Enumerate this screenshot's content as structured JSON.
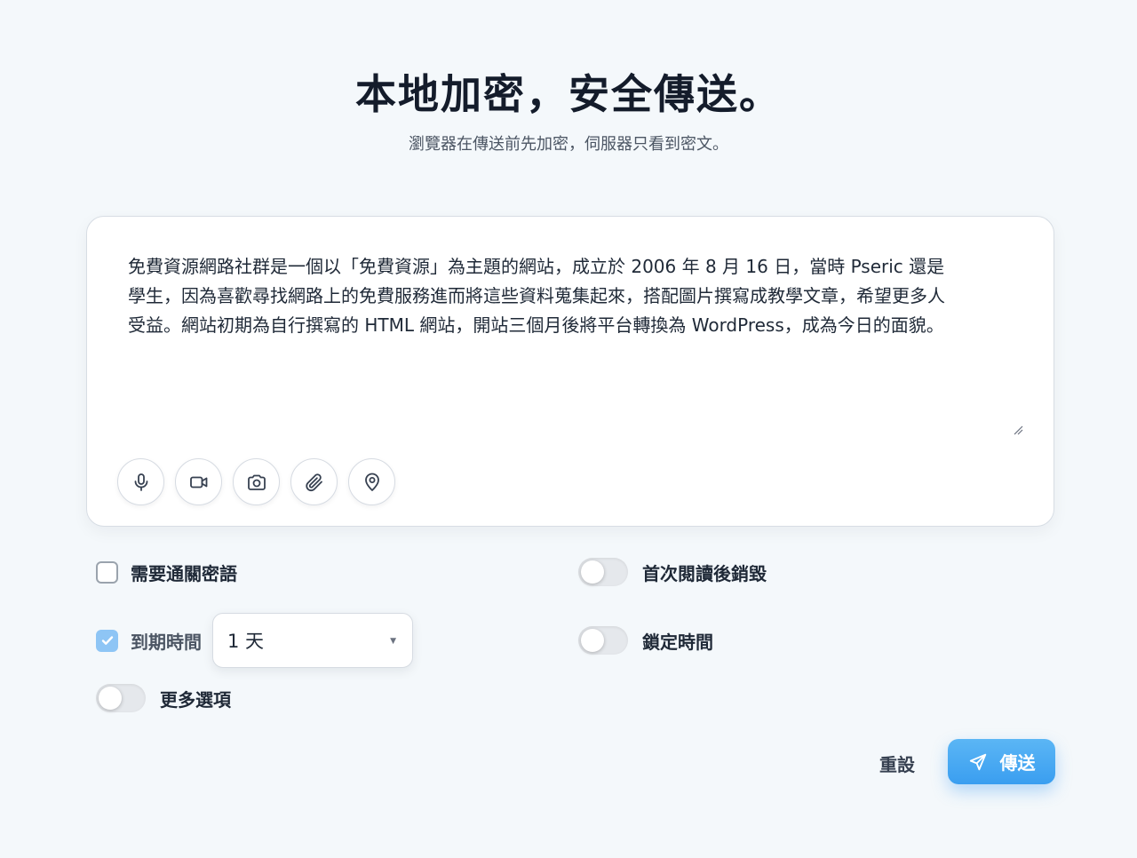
{
  "header": {
    "title": "本地加密，安全傳送。",
    "subtitle": "瀏覽器在傳送前先加密，伺服器只看到密文。"
  },
  "message": {
    "text": "免費資源網路社群是一個以「免費資源」為主題的網站，成立於 2006 年 8 月 16 日，當時 Pseric 還是\n學生，因為喜歡尋找網路上的免費服務進而將這些資料蒐集起來，搭配圖片撰寫成教學文章，希望更多人\n受益。網站初期為自行撰寫的 HTML 網站，開站三個月後將平台轉換為 WordPress，成為今日的面貌。"
  },
  "toolbar": {
    "icons": [
      "microphone-icon",
      "video-camera-icon",
      "camera-icon",
      "paperclip-icon",
      "location-pin-icon"
    ]
  },
  "options": {
    "passphrase_label": "需要通關密語",
    "passphrase_checked": false,
    "burn_label": "首次閱讀後銷毀",
    "burn_on": false,
    "expiry_label": "到期時間",
    "expiry_checked": true,
    "expiry_value": "1 天",
    "lock_time_label": "鎖定時間",
    "lock_time_on": false,
    "more_label": "更多選項",
    "more_on": false
  },
  "actions": {
    "reset_label": "重設",
    "send_label": "傳送"
  },
  "colors": {
    "accent": "#3a9ef0",
    "checkbox_checked": "#8ec5f5",
    "background": "#f4f8fb"
  }
}
